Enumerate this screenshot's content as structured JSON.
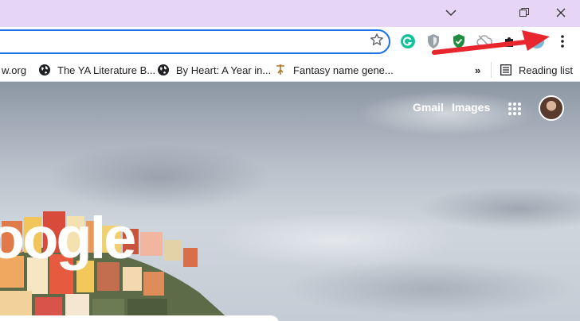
{
  "window": {
    "title_bar_color": "#e6d5f4",
    "controls": [
      "minimize-icon",
      "restore-icon",
      "close-icon"
    ]
  },
  "toolbar": {
    "omnibox_value": "",
    "extensions": [
      "grammarly-icon",
      "shield-icon",
      "security-check-icon",
      "cloud-icon",
      "puzzle-icon",
      "profile-icon",
      "more-vert-icon"
    ]
  },
  "bookmarks": {
    "items": [
      {
        "label": "w.org",
        "icon": "globe-icon"
      },
      {
        "label": "The YA Literature B...",
        "icon": "globe-icon"
      },
      {
        "label": "By Heart: A Year in...",
        "icon": "globe-icon"
      },
      {
        "label": "Fantasy name gene...",
        "icon": "bookmark-figure-icon"
      }
    ],
    "overflow_label": "»",
    "reading_list_label": "Reading list"
  },
  "ntp": {
    "gmail_label": "Gmail",
    "images_label": "Images",
    "logo_text": "oogle"
  },
  "annotation": {
    "arrow_color": "#e8262d",
    "points_to": "more-vert-icon"
  }
}
